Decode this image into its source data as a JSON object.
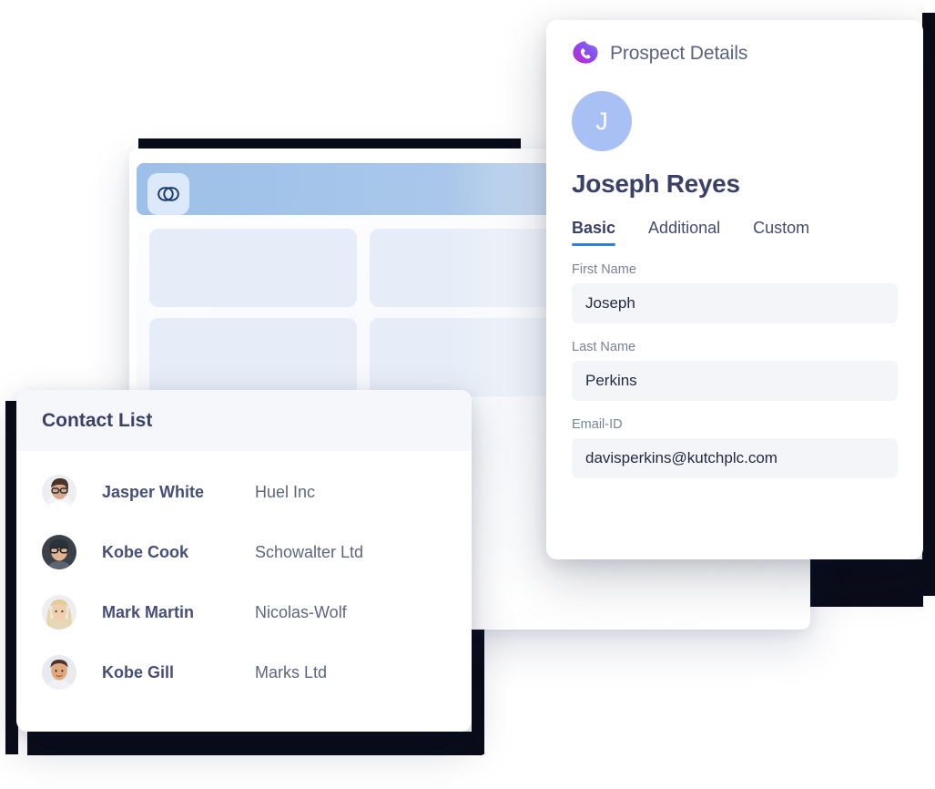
{
  "prospect_panel": {
    "brand_icon": "phone-call-icon",
    "title": "Prospect Details",
    "avatar_initial": "J",
    "avatar_color": "#a8c0f3",
    "name": "Joseph Reyes",
    "tabs": [
      {
        "label": "Basic",
        "active": true
      },
      {
        "label": "Additional",
        "active": false
      },
      {
        "label": "Custom",
        "active": false
      }
    ],
    "accent_color": "#2f7fe0",
    "fields": [
      {
        "label": "First Name",
        "value": "Joseph"
      },
      {
        "label": "Last Name",
        "value": "Perkins"
      },
      {
        "label": "Email-ID",
        "value": "davisperkins@kutchplc.com"
      }
    ]
  },
  "contact_panel": {
    "title": "Contact List",
    "header_bg": "#f6f7fb",
    "rows": [
      {
        "avatar": "avatar-jasper-white",
        "name": "Jasper White",
        "company": "Huel Inc"
      },
      {
        "avatar": "avatar-kobe-cook",
        "name": "Kobe Cook",
        "company": "Schowalter Ltd"
      },
      {
        "avatar": "avatar-mark-martin",
        "name": "Mark Martin",
        "company": "Nicolas-Wolf"
      },
      {
        "avatar": "avatar-kobe-gill",
        "name": "Kobe Gill",
        "company": "Marks Ltd"
      }
    ]
  },
  "grid_panel": {
    "topbar_icon": "chain-link-icon",
    "topbar_color": "#a9c7ea",
    "block_color": "#e6edf8",
    "block_count": 6
  }
}
